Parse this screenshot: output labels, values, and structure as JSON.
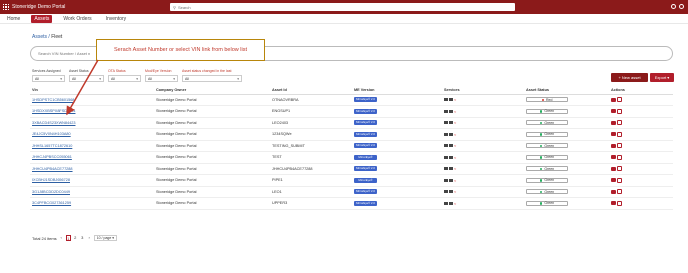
{
  "topbar": {
    "brand": "Stoneridge Demo Portal",
    "search_placeholder": "Search"
  },
  "nav": {
    "items": [
      "Home",
      "Assets",
      "Work Orders",
      "Inventory"
    ],
    "active": "Assets"
  },
  "breadcrumb": {
    "link": "Assets",
    "current": "Fleet"
  },
  "search": {
    "placeholder": "Search VIN Number / Asset n"
  },
  "callout": {
    "text": "Serach Asset Number or select VIN link from below list"
  },
  "filters": [
    {
      "label": "Services Assigned",
      "value": "All"
    },
    {
      "label": "Asset Status",
      "value": "All"
    },
    {
      "label": "OTA Status",
      "value": "All"
    },
    {
      "label": "Mod/Eye Version",
      "value": "All"
    },
    {
      "label": "Asset status changed in the last",
      "value": "All"
    }
  ],
  "buttons": {
    "new_asset": "+ New asset",
    "export": "Export"
  },
  "table": {
    "headers": [
      "Vin",
      "Company Owner",
      "Asset Id",
      "ME Version",
      "Services",
      "Asset Status",
      "Actions"
    ],
    "rows": [
      {
        "vin": "1HSDPSTC1CB5601568",
        "owner": "Stoneridge Demo Portal",
        "asset_id": "OTNAOVRBRA",
        "me": "MirrorEye® 2.0",
        "status": "Red",
        "status_color": "#d9342b"
      },
      {
        "vin": "1HSDXXBSPX8FSD7744",
        "owner": "Stoneridge Demo Portal",
        "asset_id": "ENGSUP1",
        "me": "MirrorEye® 2.0",
        "status": "Green",
        "status_color": "#27ae60"
      },
      {
        "vin": "3XBACD4S23XWN84423",
        "owner": "Stoneridge Demo Portal",
        "asset_id": "LEO2403",
        "me": "MirrorEye® 2.0",
        "status": "Green",
        "status_color": "#27ae60"
      },
      {
        "vin": "JE4JC5V0N4H103A80",
        "owner": "Stoneridge Demo Portal",
        "asset_id": "1234SQWe",
        "me": "MirrorEye® 2.0",
        "status": "Green",
        "status_color": "#27ae60"
      },
      {
        "vin": "JHHSL1657TC1872610",
        "owner": "Stoneridge Demo Portal",
        "asset_id": "TESTING_SUBMIT",
        "me": "MirrorEye® 2.0",
        "status": "Green",
        "status_color": "#27ae60"
      },
      {
        "vin": "JHHCJ4PBSCC055061",
        "owner": "Stoneridge Demo Portal",
        "asset_id": "TEST",
        "me": "MirrorEye®",
        "status": "Green",
        "status_color": "#27ae60"
      },
      {
        "vin": "JHHCU4PB4ACE77288",
        "owner": "Stoneridge Demo Portal",
        "asset_id": "JHHCU4PB4ACE77288",
        "me": "MirrorEye® 2.0",
        "status": "Green",
        "status_color": "#27ae60"
      },
      {
        "vin": "IXCBHJ1SDBJ656728",
        "owner": "Stoneridge Demo Portal",
        "asset_id": "PIPE1",
        "me": "MirrorEye®",
        "status": "Green",
        "status_color": "#27ae60"
      },
      {
        "vin": "3G1J8BCDD2DC0449",
        "owner": "Stoneridge Demo Portal",
        "asset_id": "LEO1",
        "me": "MirrorEye® 2.0",
        "status": "Green",
        "status_color": "#27ae60"
      },
      {
        "vin": "3C4PFBCG027361259",
        "owner": "Stoneridge Demo Portal",
        "asset_id": "UPPER3",
        "me": "MirrorEye® 2.0",
        "status": "Green",
        "status_color": "#27ae60"
      }
    ]
  },
  "pagination": {
    "total": "Total 24 items",
    "pages": [
      "1",
      "2",
      "3"
    ],
    "current": "1",
    "per_page": "10 / page"
  }
}
